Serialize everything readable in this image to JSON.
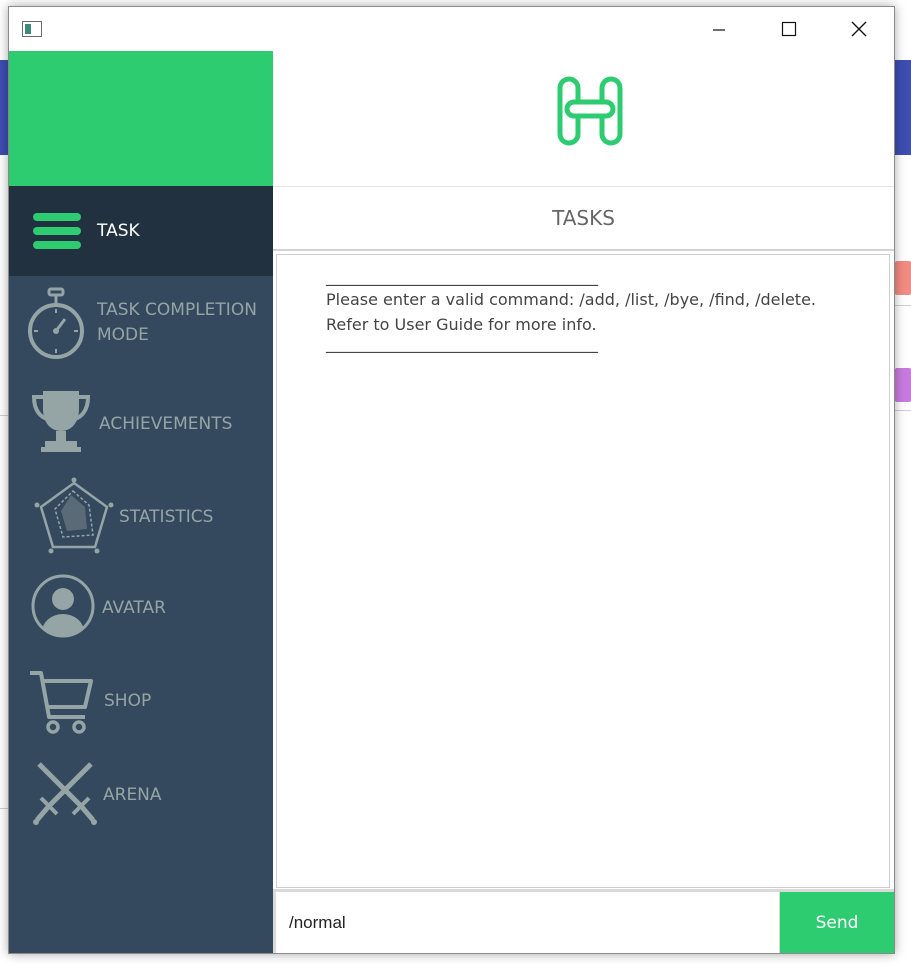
{
  "window": {
    "minimize_icon": "minimize-icon",
    "maximize_icon": "maximize-icon",
    "close_icon": "close-icon"
  },
  "colors": {
    "accent_green": "#2ecc71",
    "sidebar_bg": "#34495e",
    "sidebar_active_bg": "#22313f",
    "nav_text": "#95a5a6"
  },
  "sidebar": {
    "items": [
      {
        "label": "TASK",
        "icon": "menu-icon",
        "active": true
      },
      {
        "label": "TASK COMPLETION\nMODE",
        "icon": "stopwatch-icon",
        "active": false
      },
      {
        "label": "ACHIEVEMENTS",
        "icon": "trophy-icon",
        "active": false
      },
      {
        "label": "STATISTICS",
        "icon": "radar-chart-icon",
        "active": false
      },
      {
        "label": "AVATAR",
        "icon": "user-avatar-icon",
        "active": false
      },
      {
        "label": "SHOP",
        "icon": "shopping-cart-icon",
        "active": false
      },
      {
        "label": "ARENA",
        "icon": "crossed-swords-icon",
        "active": false
      }
    ]
  },
  "main": {
    "logo_icon": "h-logo-icon",
    "title": "TASKS",
    "output": {
      "lines": [
        "__________________________________",
        "Please enter a valid command: /add, /list, /bye, /find, /delete.",
        "Refer to User Guide for more info.",
        "__________________________________"
      ]
    },
    "input": {
      "value": "/normal"
    },
    "send_label": "Send"
  }
}
